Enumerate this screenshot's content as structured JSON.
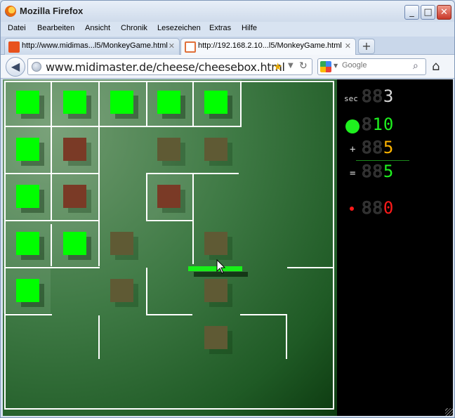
{
  "window": {
    "title": "Mozilla Firefox",
    "minimize": "_",
    "maximize": "□",
    "close": "✕"
  },
  "menu": [
    "Datei",
    "Bearbeiten",
    "Ansicht",
    "Chronik",
    "Lesezeichen",
    "Extras",
    "Hilfe"
  ],
  "tabs": [
    {
      "label": "http://www.midimas...l5/MonkeyGame.html",
      "close": "✕",
      "icon": "html5-icon",
      "active": false
    },
    {
      "label": "http://192.168.2.10...l5/MonkeyGame.html",
      "close": "✕",
      "icon": "document-error-icon",
      "active": true
    }
  ],
  "new_tab_label": "+",
  "nav": {
    "back": "◀",
    "url": "www.midimaster.de/cheese/cheesebox.html",
    "bookmark_star": "★",
    "dropdown": "▼",
    "reload": "↻",
    "search_placeholder": "Google",
    "search_icon": "⌕",
    "home": "⌂"
  },
  "game": {
    "colors": {
      "green": "#00ff00",
      "red": "#7a3a26",
      "olive": "#5f5a34",
      "wall": "#ffffff"
    },
    "panel": {
      "sec_label": "sec",
      "sec_value": "3",
      "sec_dim": "88",
      "collected_dim": "8",
      "collected_value": "10",
      "plus_label": "+",
      "plus_dim": "88",
      "plus_value": "5",
      "equals_label": "=",
      "equals_dim": "88",
      "equals_value": "5",
      "lost_dim": "88",
      "lost_value": "0"
    }
  }
}
